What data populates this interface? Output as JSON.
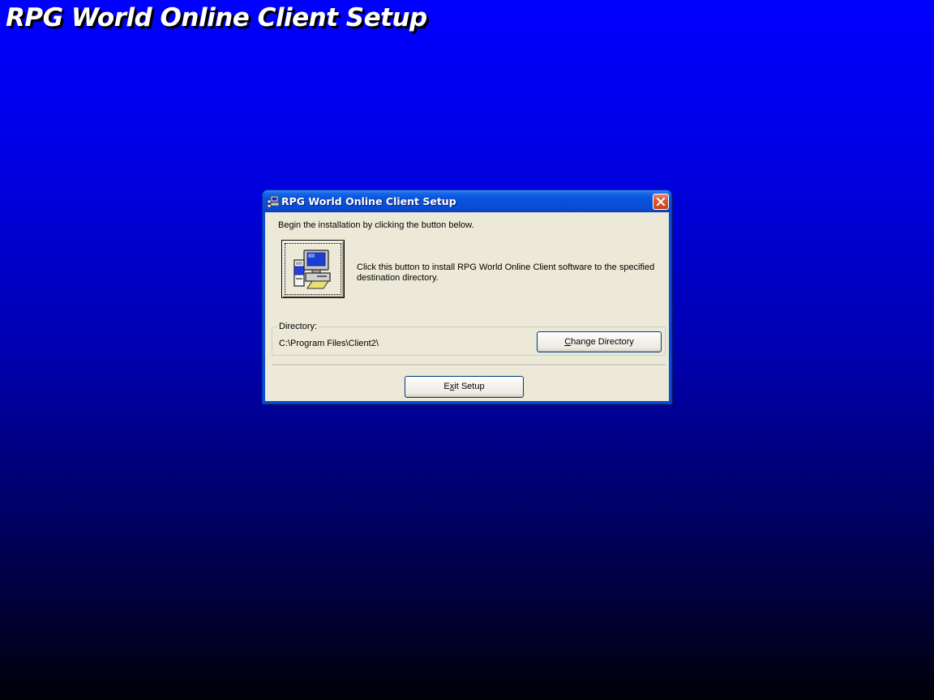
{
  "banner": {
    "title": "RPG World Online Client Setup"
  },
  "dialog": {
    "title": "RPG World Online Client Setup",
    "title_icon": "setup-computer-icon",
    "close_icon": "close-icon",
    "intro_text": "Begin the installation by clicking the button below.",
    "install_button_icon": "install-computer-icon",
    "install_description": "Click this button to install RPG World Online Client software to the specified destination directory.",
    "directory": {
      "label": "Directory:",
      "path": "C:\\Program Files\\Client2\\",
      "change_button": {
        "mnemonic": "C",
        "rest": "hange Directory"
      }
    },
    "exit_button": {
      "mnemonic": "x",
      "before": "E",
      "after": "it Setup"
    }
  },
  "colors": {
    "desktop_top": "#0000ff",
    "desktop_bottom": "#000008",
    "dialog_face": "#ece9d8",
    "titlebar_blue": "#0a4fd7",
    "close_red": "#d85a33"
  }
}
